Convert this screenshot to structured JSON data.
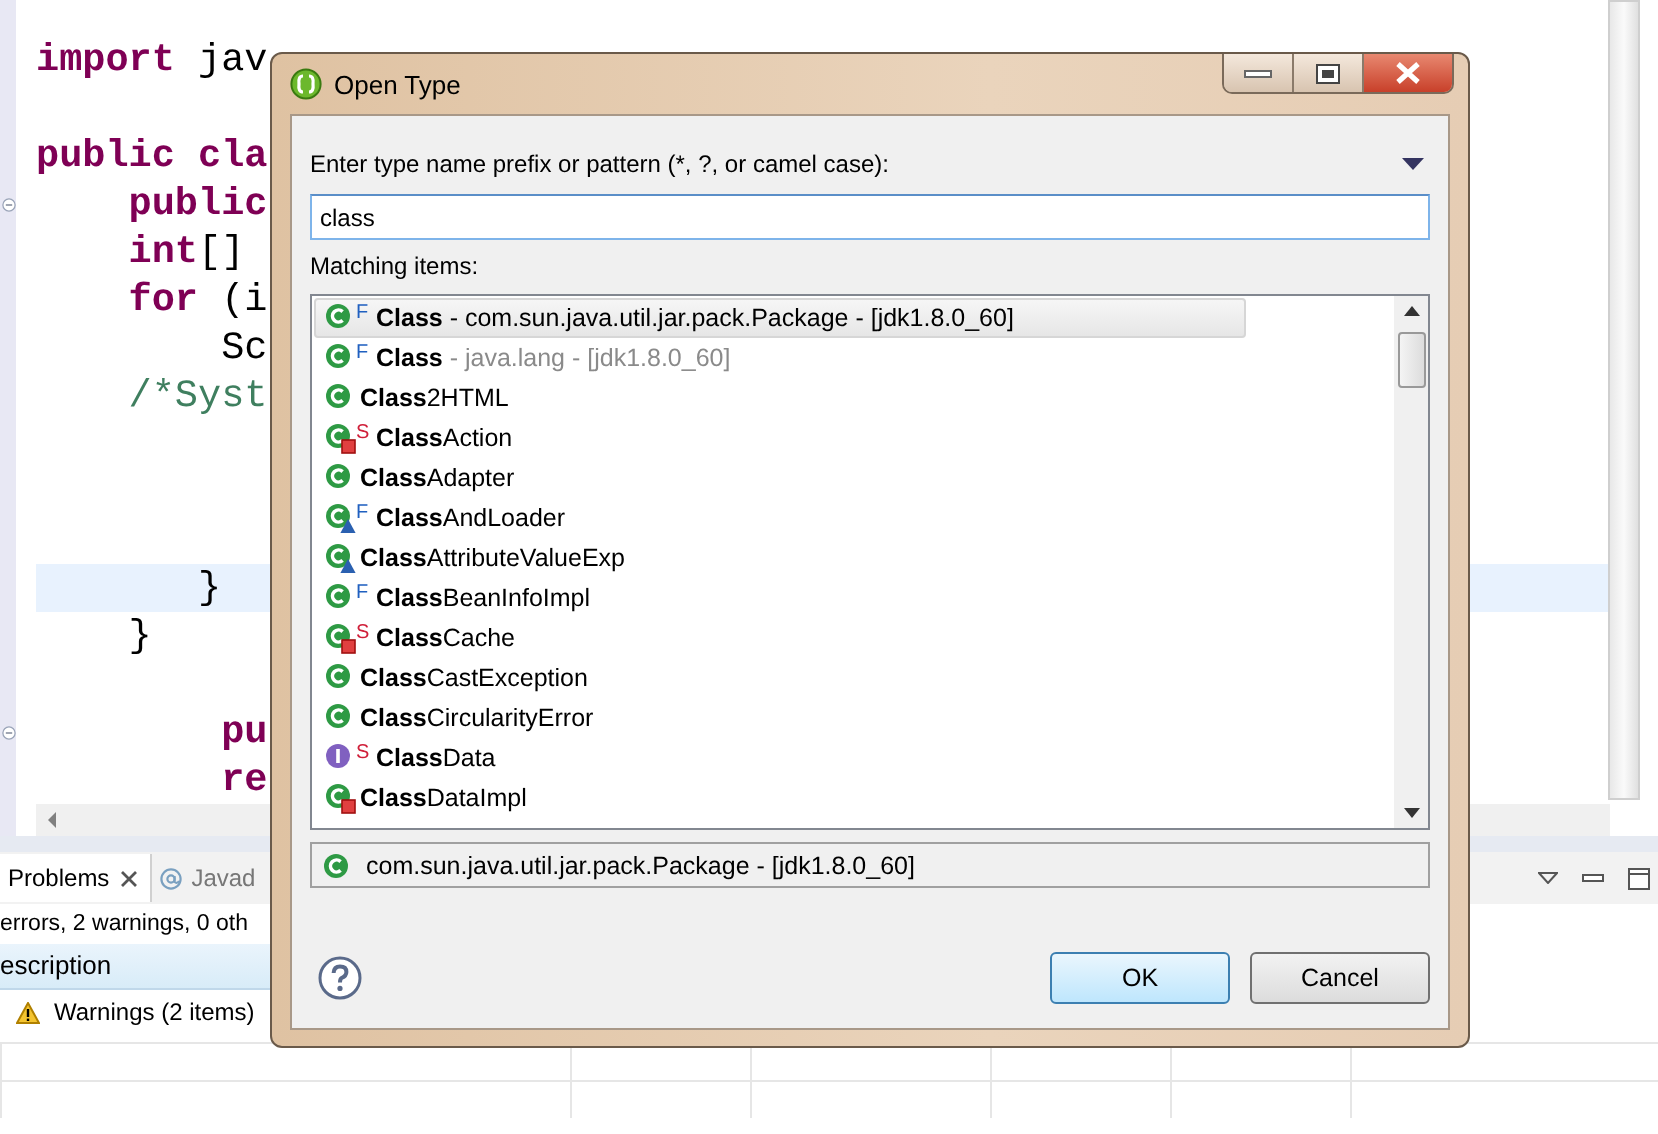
{
  "editor": {
    "lines": [
      {
        "current": false,
        "fold": false,
        "segments": [
          {
            "text": "import",
            "kind": "keyword"
          },
          {
            "text": " jav",
            "kind": "plain"
          }
        ]
      },
      {
        "current": false,
        "fold": false
      },
      {
        "current": false,
        "fold": false,
        "segments": [
          {
            "text": "public cla",
            "kind": "keyword"
          }
        ]
      },
      {
        "current": false,
        "fold": true,
        "segments": [
          {
            "text": "    public",
            "kind": "keyword"
          }
        ]
      },
      {
        "current": false,
        "fold": false,
        "segments": [
          {
            "text": "    int",
            "kind": "keyword"
          },
          {
            "text": "[]",
            "kind": "plain"
          }
        ]
      },
      {
        "current": false,
        "fold": false,
        "segments": [
          {
            "text": "    for",
            "kind": "keyword"
          },
          {
            "text": " (i",
            "kind": "plain"
          }
        ]
      },
      {
        "current": false,
        "fold": false,
        "segments": [
          {
            "text": "        Sc",
            "kind": "plain"
          }
        ]
      },
      {
        "current": false,
        "fold": false,
        "segments": [
          {
            "text": "    /*Syst",
            "kind": "comment"
          }
        ]
      },
      {
        "current": false,
        "fold": false
      },
      {
        "current": false,
        "fold": false
      },
      {
        "current": false,
        "fold": false
      },
      {
        "current": true,
        "fold": false,
        "segments": [
          {
            "text": "       }",
            "kind": "plain"
          }
        ]
      },
      {
        "current": false,
        "fold": false,
        "segments": [
          {
            "text": "    }",
            "kind": "plain"
          }
        ]
      },
      {
        "current": false,
        "fold": false
      },
      {
        "current": false,
        "fold": true,
        "segments": [
          {
            "text": "        pu",
            "kind": "keyword"
          }
        ]
      },
      {
        "current": false,
        "fold": false,
        "segments": [
          {
            "text": "        re",
            "kind": "keyword"
          }
        ]
      }
    ]
  },
  "problems": {
    "tabs": [
      {
        "label": "Problems",
        "selected": true
      },
      {
        "label": "Javad",
        "selected": false
      }
    ],
    "summary": "errors, 2 warnings, 0 oth",
    "column": "escription",
    "rows": [
      {
        "label": "Warnings (2 items)"
      }
    ]
  },
  "dialog": {
    "title": "Open Type",
    "prompt": "Enter type name prefix or pattern (*, ?, or camel case):",
    "search": {
      "value": "class"
    },
    "list_label": "Matching items:",
    "items": [
      {
        "kind": "class",
        "private": false,
        "protected": false,
        "modifier": {
          "text": "F",
          "kind": "final"
        },
        "name": "Class",
        "qualifier": " - com.sun.java.util.jar.pack.Package - [jdk1.8.0_60]",
        "selected": true
      },
      {
        "kind": "class",
        "private": false,
        "protected": false,
        "modifier": {
          "text": "F",
          "kind": "final"
        },
        "name": "Class",
        "qualifier": " - java.lang - [jdk1.8.0_60]",
        "selected": false
      },
      {
        "kind": "class",
        "private": false,
        "protected": false,
        "name": "**Class**2HTML",
        "selected": false
      },
      {
        "kind": "class",
        "private": true,
        "protected": false,
        "modifier": {
          "text": "S",
          "kind": "static"
        },
        "name": "**Class**Action",
        "selected": false
      },
      {
        "kind": "class",
        "private": false,
        "protected": false,
        "name": "**Class**Adapter",
        "selected": false
      },
      {
        "kind": "class",
        "private": false,
        "protected": true,
        "modifier": {
          "text": "F",
          "kind": "final"
        },
        "name": "**Class**AndLoader",
        "selected": false
      },
      {
        "kind": "class",
        "private": false,
        "protected": true,
        "name": "**Class**AttributeValueExp",
        "selected": false
      },
      {
        "kind": "class",
        "private": false,
        "protected": false,
        "modifier": {
          "text": "F",
          "kind": "final"
        },
        "name": "**Class**BeanInfoImpl",
        "selected": false
      },
      {
        "kind": "class",
        "private": true,
        "protected": false,
        "modifier": {
          "text": "S",
          "kind": "static"
        },
        "name": "**Class**Cache",
        "selected": false
      },
      {
        "kind": "class",
        "private": false,
        "protected": false,
        "name": "**Class**CastException",
        "selected": false
      },
      {
        "kind": "class",
        "private": false,
        "protected": false,
        "name": "**Class**CircularityError",
        "selected": false
      },
      {
        "kind": "interface",
        "private": false,
        "protected": false,
        "modifier": {
          "text": "S",
          "kind": "static"
        },
        "name": "**Class**Data",
        "selected": false
      },
      {
        "kind": "class",
        "private": true,
        "protected": false,
        "name": "**Class**DataImpl",
        "selected": false
      }
    ],
    "details": {
      "kind": "class",
      "text": "com.sun.java.util.jar.pack.Package - [jdk1.8.0_60]"
    },
    "buttons": [
      {
        "label": "OK",
        "default": true
      },
      {
        "label": "Cancel",
        "default": false
      }
    ]
  }
}
